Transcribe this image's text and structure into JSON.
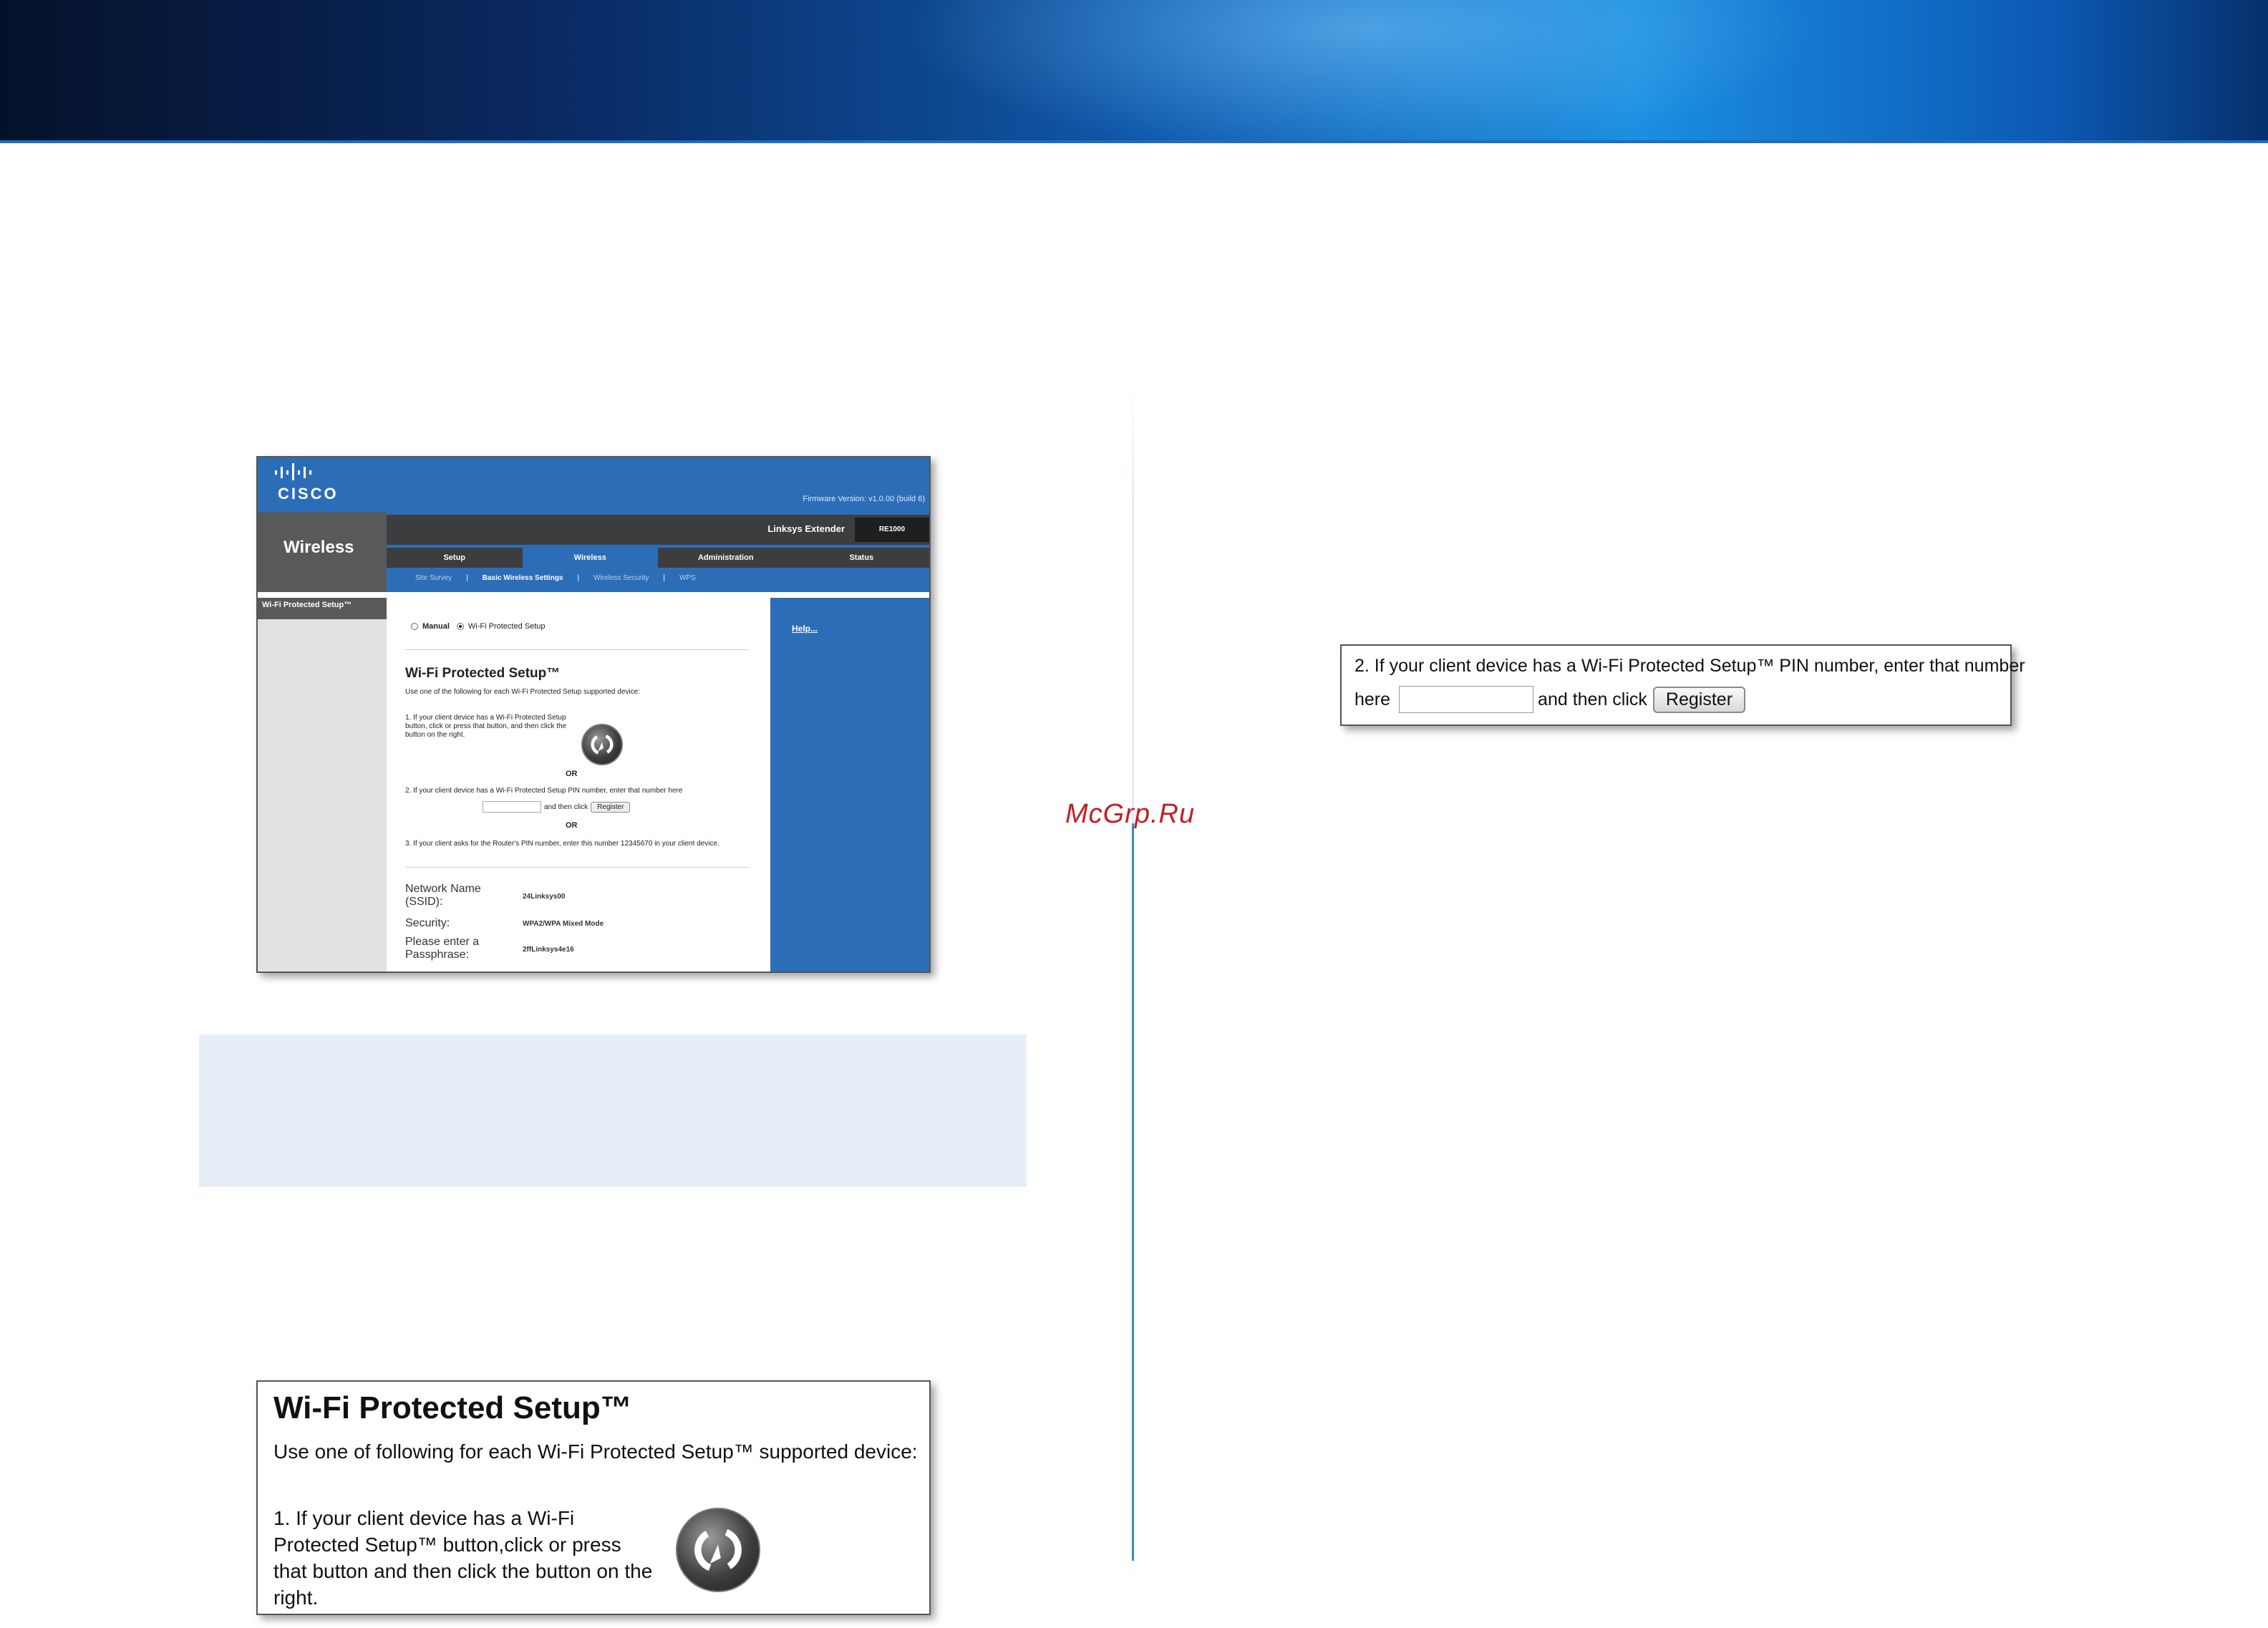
{
  "watermark": "McGrp.Ru",
  "shot1": {
    "cisco_logo": "CISCO",
    "firmware": "Firmware Version: v1.0.00 (build 6)",
    "page_title": "Wireless",
    "product_name": "Linksys Extender",
    "model": "RE1000",
    "tabs": [
      "Setup",
      "Wireless",
      "Administration",
      "Status"
    ],
    "active_tab": "Wireless",
    "subtabs": [
      "Site Survey",
      "Basic Wireless Settings",
      "Wireless Security",
      "WPS"
    ],
    "side_heading": "Wi-Fi Protected Setup™",
    "mode_manual": "Manual",
    "mode_wps": "Wi-Fi Protected Setup",
    "wps_title": "Wi-Fi Protected Setup™",
    "intro": "Use one of the following for each Wi-Fi Protected Setup supported device:",
    "option1": "1. If your client device has a Wi-Fi Protected Setup button, click or press that button, and then click the button on the right.",
    "or": "OR",
    "option2": "2. If your client device has a Wi-Fi Protected Setup PIN number, enter that number here",
    "option2_then": "and then click",
    "register_label": "Register",
    "option3": "3. If your client asks for the Router's PIN number, enter this number 12345670 in your client device.",
    "network_name_label": "Network Name (SSID):",
    "network_name_value": "24Linksys00",
    "security_label": "Security:",
    "security_value": "WPA2/WPA Mixed Mode",
    "passphrase_label": "Please enter a Passphrase:",
    "passphrase_value": "2ffLinksys4e16",
    "help_link": "Help..."
  },
  "shot2": {
    "title": "Wi-Fi Protected Setup™",
    "intro": "Use one of following for each Wi-Fi Protected Setup™ supported device:",
    "option1": "1. If your client device has a Wi-Fi Protected Setup™ button,click or press that button and then click the button on the right."
  },
  "shot3": {
    "line1": "2. If your client device has a Wi-Fi Protected Setup™ PIN number, enter that number",
    "here": "here",
    "then_click": "and then click",
    "register_label": "Register"
  }
}
